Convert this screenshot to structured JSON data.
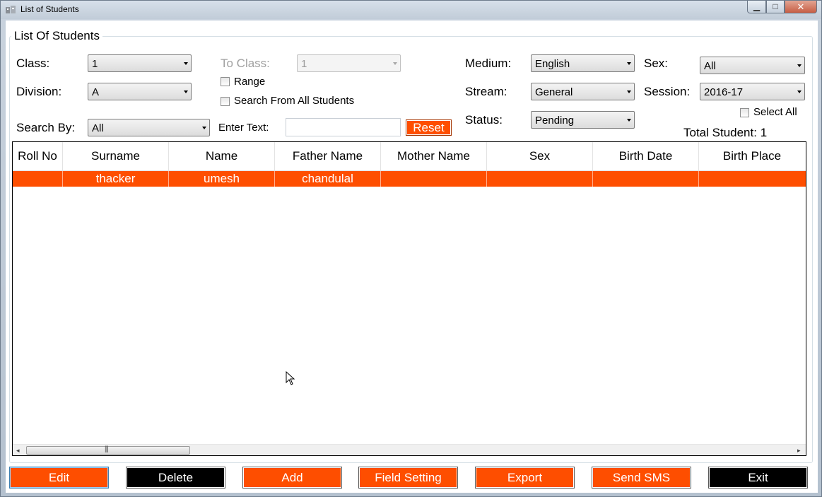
{
  "window": {
    "title": "List of Students",
    "minimize_glyph": "▁",
    "maximize_glyph": "□",
    "close_glyph": "✕"
  },
  "filters": {
    "group_title": "List Of Students",
    "class_label": "Class:",
    "class_value": "1",
    "division_label": "Division:",
    "division_value": "A",
    "to_class_label": "To Class:",
    "to_class_value": "1",
    "range_label": "Range",
    "search_all_label": "Search From All Students",
    "medium_label": "Medium:",
    "medium_value": "English",
    "stream_label": "Stream:",
    "stream_value": "General",
    "status_label": "Status:",
    "status_value": "Pending",
    "sex_label": "Sex:",
    "sex_value": "All",
    "session_label": "Session:",
    "session_value": "2016-17",
    "select_all_label": "Select All",
    "search_by_label": "Search By:",
    "search_by_value": "All",
    "enter_text_label": "Enter Text:",
    "enter_text_value": "",
    "reset_label": "Reset",
    "total_label": "Total Student:",
    "total_value": "1"
  },
  "grid": {
    "columns": [
      "Roll No",
      "Surname",
      "Name",
      "Father Name",
      "Mother Name",
      "Sex",
      "Birth Date",
      "Birth Place"
    ],
    "rows": [
      [
        "",
        "thacker",
        "umesh",
        "chandulal",
        "",
        "",
        "",
        ""
      ]
    ],
    "scroll_grip": "|||",
    "scroll_left_glyph": "◂",
    "scroll_right_glyph": "▸"
  },
  "actions": {
    "edit": "Edit",
    "delete": "Delete",
    "add": "Add",
    "field_setting": "Field Setting",
    "export": "Export",
    "send_sms": "Send SMS",
    "exit": "Exit"
  },
  "colors": {
    "accent": "#fe4e00",
    "button_dark": "#000000"
  }
}
